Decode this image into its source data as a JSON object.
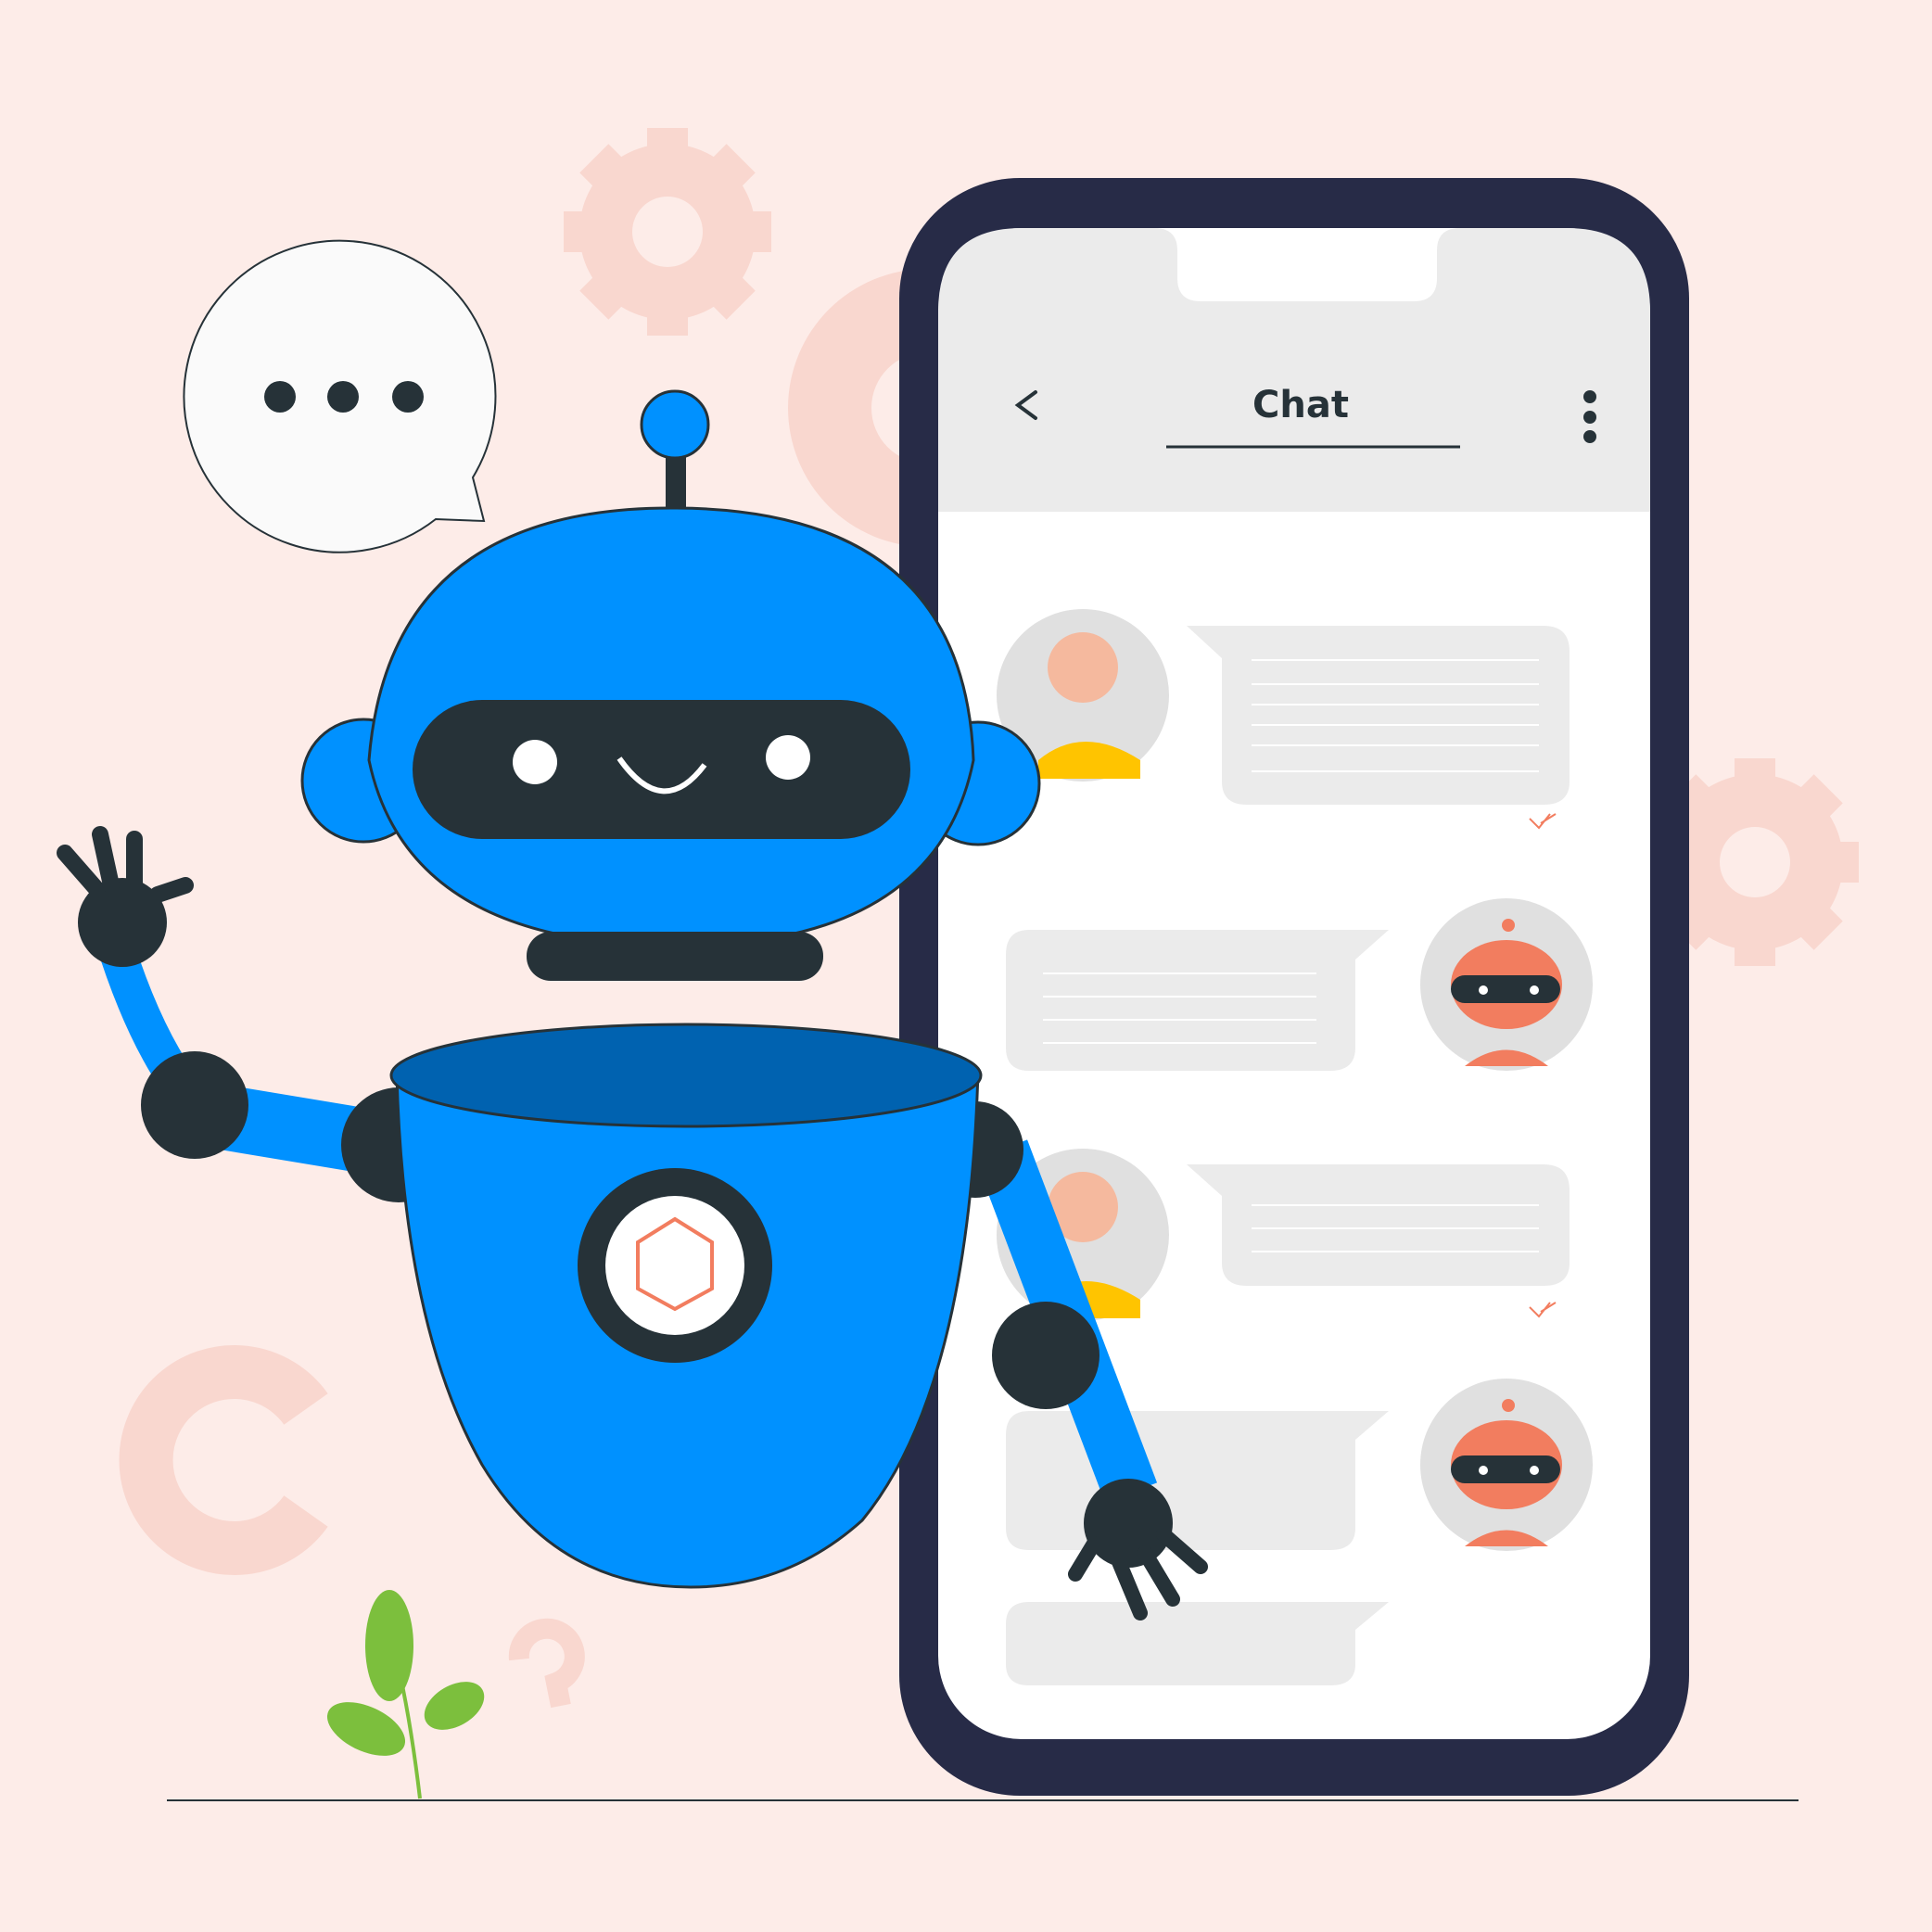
{
  "colors": {
    "background": "#fdece8",
    "gear": "#f9d7cf",
    "phone_frame": "#272b47",
    "screen": "#ffffff",
    "header": "#ebebeb",
    "bubble": "#ebebeb",
    "avatar_bg": "#e0e0e0",
    "robot_blue": "#0091ff",
    "robot_blue_dark": "#0062b0",
    "robot_dark": "#263238",
    "accent_red": "#f27d5f",
    "user_shirt": "#ffc400",
    "plant": "#7cbf3d"
  },
  "phone": {
    "header": {
      "title": "Chat",
      "back_icon": "chevron-left-icon",
      "menu_icon": "kebab-menu-icon"
    },
    "messages": [
      {
        "sender": "user",
        "avatar": "woman-avatar",
        "status_icon": "double-check-icon"
      },
      {
        "sender": "bot",
        "avatar": "robot-avatar"
      },
      {
        "sender": "user",
        "avatar": "woman-avatar",
        "status_icon": "double-check-icon"
      },
      {
        "sender": "bot",
        "avatar": "robot-avatar"
      },
      {
        "sender": "bot"
      }
    ]
  },
  "speech_bubble": {
    "icon": "typing-dots-icon"
  },
  "decorations": [
    "gear-icon",
    "gear-icon",
    "gear-icon",
    "question-mark-icon",
    "question-mark-icon",
    "plant-icon"
  ]
}
